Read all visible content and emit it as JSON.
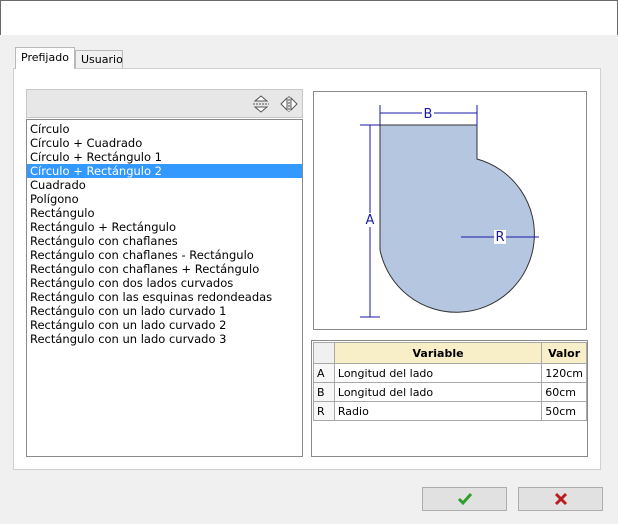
{
  "tabs": [
    {
      "label": "Prefijado",
      "active": true
    },
    {
      "label": "Usuario",
      "active": false
    }
  ],
  "toolbar": {
    "icons": [
      "sort-vertical-icon",
      "mirror-horizontal-icon"
    ]
  },
  "shapes_list": {
    "selected_index": 3,
    "items": [
      "Círculo",
      "Círculo + Cuadrado",
      "Círculo + Rectángulo 1",
      "Círculo + Rectángulo 2",
      "Cuadrado",
      "Polígono",
      "Rectángulo",
      "Rectángulo + Rectángulo",
      "Rectángulo con chaflanes",
      "Rectángulo con chaflanes - Rectángulo",
      "Rectángulo con chaflanes + Rectángulo",
      "Rectángulo con dos lados curvados",
      "Rectángulo con las esquinas redondeadas",
      "Rectángulo con un lado curvado 1",
      "Rectángulo con un lado curvado 2",
      "Rectángulo con un lado curvado 3"
    ]
  },
  "preview": {
    "labels": {
      "a": "A",
      "b": "B",
      "r": "R"
    },
    "fill_color": "#b4c6e0",
    "dimension_color": "#1a1aa6"
  },
  "variables_table": {
    "headers": {
      "variable": "Variable",
      "value": "Valor"
    },
    "rows": [
      {
        "key": "A",
        "variable": "Longitud del lado",
        "value": "120cm"
      },
      {
        "key": "B",
        "variable": "Longitud del lado",
        "value": "60cm"
      },
      {
        "key": "R",
        "variable": "Radio",
        "value": "50cm"
      }
    ]
  },
  "buttons": {
    "ok_icon": "checkmark-icon",
    "cancel_icon": "x-icon",
    "ok_color": "#2e9e2e",
    "cancel_color": "#b81e1e"
  }
}
